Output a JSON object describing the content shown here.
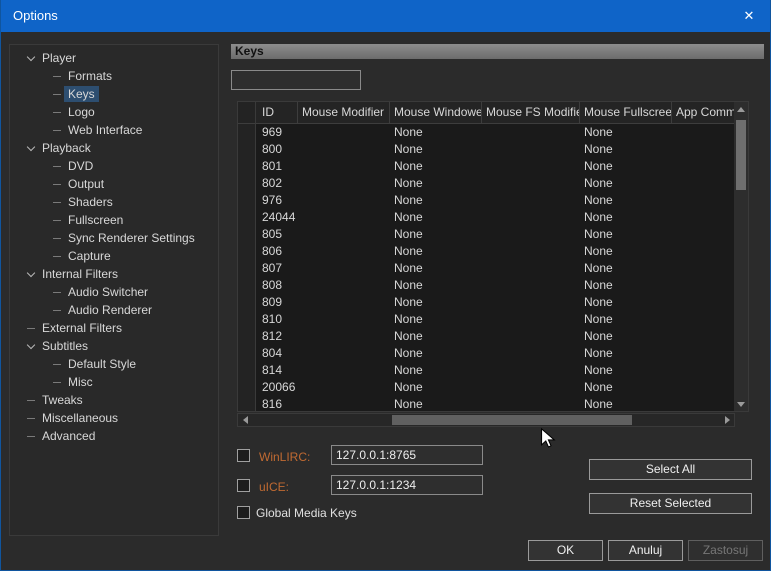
{
  "window": {
    "title": "Options",
    "close_glyph": "✕"
  },
  "colors": {
    "titlebar": "#0f64c8",
    "winlirc_label": "#c06a32",
    "uice_label": "#c06a32",
    "tree_selection": "#2d4e70"
  },
  "tree": {
    "items": [
      {
        "label": "Player",
        "level": 0,
        "glyph": "chevron",
        "selected": false
      },
      {
        "label": "Formats",
        "level": 1,
        "glyph": "dash",
        "selected": false
      },
      {
        "label": "Keys",
        "level": 1,
        "glyph": "dash",
        "selected": true
      },
      {
        "label": "Logo",
        "level": 1,
        "glyph": "dash",
        "selected": false
      },
      {
        "label": "Web Interface",
        "level": 1,
        "glyph": "dash",
        "selected": false
      },
      {
        "label": "Playback",
        "level": 0,
        "glyph": "chevron",
        "selected": false
      },
      {
        "label": "DVD",
        "level": 1,
        "glyph": "dash",
        "selected": false
      },
      {
        "label": "Output",
        "level": 1,
        "glyph": "dash",
        "selected": false
      },
      {
        "label": "Shaders",
        "level": 1,
        "glyph": "dash",
        "selected": false
      },
      {
        "label": "Fullscreen",
        "level": 1,
        "glyph": "dash",
        "selected": false
      },
      {
        "label": "Sync Renderer Settings",
        "level": 1,
        "glyph": "dash",
        "selected": false
      },
      {
        "label": "Capture",
        "level": 1,
        "glyph": "dash",
        "selected": false
      },
      {
        "label": "Internal Filters",
        "level": 0,
        "glyph": "chevron",
        "selected": false
      },
      {
        "label": "Audio Switcher",
        "level": 1,
        "glyph": "dash",
        "selected": false
      },
      {
        "label": "Audio Renderer",
        "level": 1,
        "glyph": "dash",
        "selected": false
      },
      {
        "label": "External Filters",
        "level": 0,
        "glyph": "dash",
        "selected": false
      },
      {
        "label": "Subtitles",
        "level": 0,
        "glyph": "chevron",
        "selected": false
      },
      {
        "label": "Default Style",
        "level": 1,
        "glyph": "dash",
        "selected": false
      },
      {
        "label": "Misc",
        "level": 1,
        "glyph": "dash",
        "selected": false
      },
      {
        "label": "Tweaks",
        "level": 0,
        "glyph": "dash",
        "selected": false
      },
      {
        "label": "Miscellaneous",
        "level": 0,
        "glyph": "dash",
        "selected": false
      },
      {
        "label": "Advanced",
        "level": 0,
        "glyph": "dash",
        "selected": false
      }
    ]
  },
  "content": {
    "header": "Keys",
    "filter": {
      "value": "",
      "placeholder": ""
    },
    "table": {
      "columns": [
        "",
        "ID",
        "Mouse Modifier",
        "Mouse Windowed",
        "Mouse FS Modifier",
        "Mouse Fullscreen",
        "App Comma"
      ],
      "rows": [
        {
          "id": "969",
          "mouse_modifier": "",
          "mouse_windowed": "None",
          "mouse_fs_modifier": "",
          "mouse_fullscreen": "None",
          "app_command": ""
        },
        {
          "id": "800",
          "mouse_modifier": "",
          "mouse_windowed": "None",
          "mouse_fs_modifier": "",
          "mouse_fullscreen": "None",
          "app_command": ""
        },
        {
          "id": "801",
          "mouse_modifier": "",
          "mouse_windowed": "None",
          "mouse_fs_modifier": "",
          "mouse_fullscreen": "None",
          "app_command": ""
        },
        {
          "id": "802",
          "mouse_modifier": "",
          "mouse_windowed": "None",
          "mouse_fs_modifier": "",
          "mouse_fullscreen": "None",
          "app_command": ""
        },
        {
          "id": "976",
          "mouse_modifier": "",
          "mouse_windowed": "None",
          "mouse_fs_modifier": "",
          "mouse_fullscreen": "None",
          "app_command": ""
        },
        {
          "id": "24044",
          "mouse_modifier": "",
          "mouse_windowed": "None",
          "mouse_fs_modifier": "",
          "mouse_fullscreen": "None",
          "app_command": ""
        },
        {
          "id": "805",
          "mouse_modifier": "",
          "mouse_windowed": "None",
          "mouse_fs_modifier": "",
          "mouse_fullscreen": "None",
          "app_command": ""
        },
        {
          "id": "806",
          "mouse_modifier": "",
          "mouse_windowed": "None",
          "mouse_fs_modifier": "",
          "mouse_fullscreen": "None",
          "app_command": ""
        },
        {
          "id": "807",
          "mouse_modifier": "",
          "mouse_windowed": "None",
          "mouse_fs_modifier": "",
          "mouse_fullscreen": "None",
          "app_command": ""
        },
        {
          "id": "808",
          "mouse_modifier": "",
          "mouse_windowed": "None",
          "mouse_fs_modifier": "",
          "mouse_fullscreen": "None",
          "app_command": ""
        },
        {
          "id": "809",
          "mouse_modifier": "",
          "mouse_windowed": "None",
          "mouse_fs_modifier": "",
          "mouse_fullscreen": "None",
          "app_command": ""
        },
        {
          "id": "810",
          "mouse_modifier": "",
          "mouse_windowed": "None",
          "mouse_fs_modifier": "",
          "mouse_fullscreen": "None",
          "app_command": ""
        },
        {
          "id": "812",
          "mouse_modifier": "",
          "mouse_windowed": "None",
          "mouse_fs_modifier": "",
          "mouse_fullscreen": "None",
          "app_command": ""
        },
        {
          "id": "804",
          "mouse_modifier": "",
          "mouse_windowed": "None",
          "mouse_fs_modifier": "",
          "mouse_fullscreen": "None",
          "app_command": ""
        },
        {
          "id": "814",
          "mouse_modifier": "",
          "mouse_windowed": "None",
          "mouse_fs_modifier": "",
          "mouse_fullscreen": "None",
          "app_command": ""
        },
        {
          "id": "20066",
          "mouse_modifier": "",
          "mouse_windowed": "None",
          "mouse_fs_modifier": "",
          "mouse_fullscreen": "None",
          "app_command": ""
        },
        {
          "id": "816",
          "mouse_modifier": "",
          "mouse_windowed": "None",
          "mouse_fs_modifier": "",
          "mouse_fullscreen": "None",
          "app_command": ""
        }
      ]
    },
    "winlirc": {
      "label": "WinLIRC:",
      "value": "127.0.0.1:8765",
      "checked": false
    },
    "uice": {
      "label": "uICE:",
      "value": "127.0.0.1:1234",
      "checked": false
    },
    "global_media_keys_label": "Global Media Keys",
    "buttons": {
      "select_all": "Select All",
      "reset_selected": "Reset Selected"
    }
  },
  "footer": {
    "ok": "OK",
    "cancel": "Anuluj",
    "apply": "Zastosuj"
  }
}
